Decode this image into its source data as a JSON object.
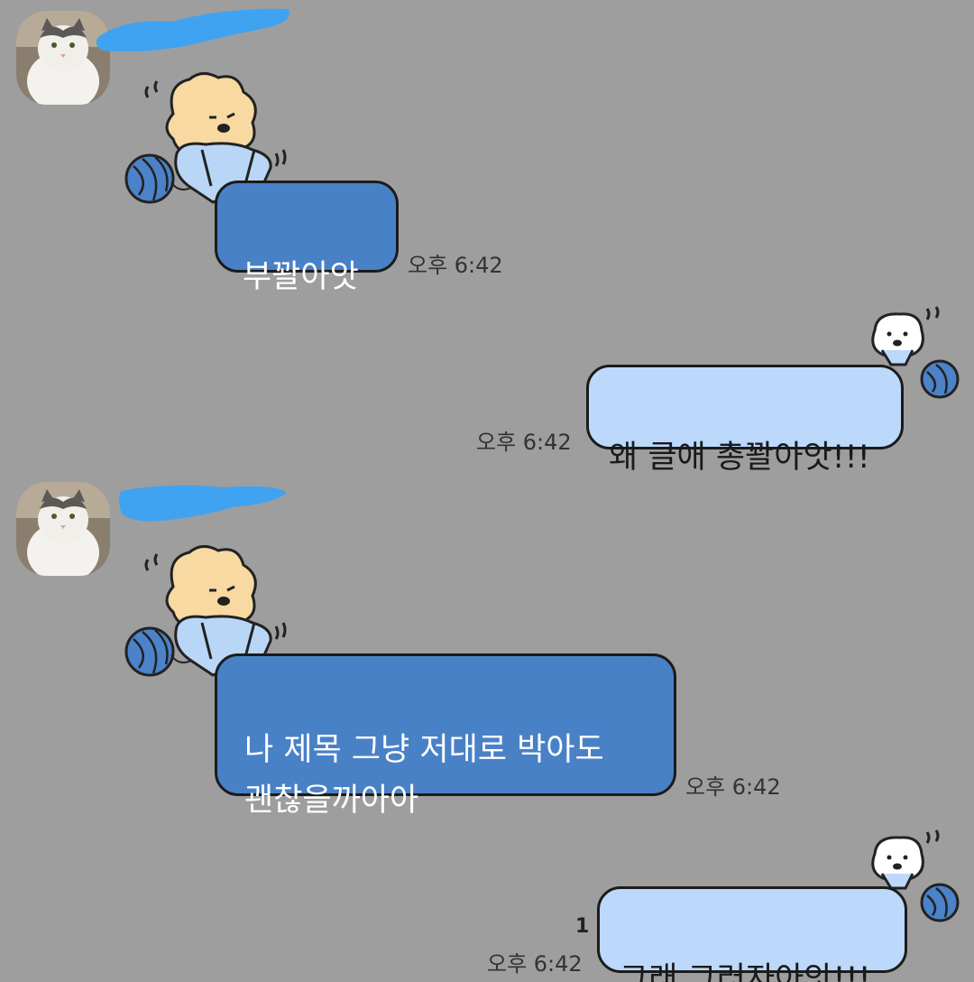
{
  "messages": [
    {
      "id": "m1",
      "direction": "incoming",
      "text": "부꽐아앗",
      "time": "오후 6:42",
      "show_avatar": true,
      "sender_name_redacted": true
    },
    {
      "id": "m2",
      "direction": "outgoing",
      "text": "왜 글애 총꽐아앗!!!",
      "time": "오후 6:42"
    },
    {
      "id": "m3",
      "direction": "incoming",
      "text": "나 제목 그냥 저대로 박아도\n괜찮을까아아",
      "time": "오후 6:42",
      "show_avatar": true,
      "sender_name_redacted": true
    },
    {
      "id": "m4",
      "direction": "outgoing",
      "text": "그래 그러자아앗!!!",
      "time": "오후 6:42",
      "unread_count": "1"
    }
  ],
  "stickers": {
    "incoming": "bear-knitting-sticker",
    "outgoing": "white-bear-knitting-sticker"
  },
  "colors": {
    "background": "#9e9e9e",
    "incoming_bubble": "#4981c7",
    "outgoing_bubble": "#bcd9fb",
    "redaction": "#3fa3f2"
  }
}
